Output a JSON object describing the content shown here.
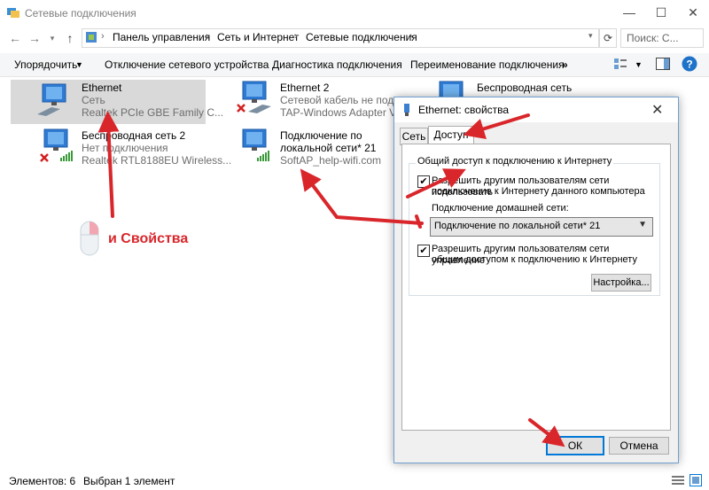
{
  "window": {
    "title": "Сетевые подключения"
  },
  "breadcrumb": [
    "Панель управления",
    "Сеть и Интернет",
    "Сетевые подключения"
  ],
  "search": {
    "placeholder": "Поиск: С..."
  },
  "toolbar": {
    "organize": "Упорядочить",
    "disable": "Отключение сетевого устройства",
    "diagnose": "Диагностика подключения",
    "rename": "Переименование подключения",
    "more": "»"
  },
  "items": [
    {
      "name": "Ethernet",
      "status": "Сеть",
      "adapter": "Realtek PCIe GBE Family C..."
    },
    {
      "name": "Ethernet 2",
      "status": "Сетевой кабель не подкл...",
      "adapter": "TAP-Windows Adapter V9"
    },
    {
      "name": "Беспроводная сеть",
      "status": "",
      "adapter": ""
    },
    {
      "name": "Беспроводная сеть 2",
      "status": "Нет подключения",
      "adapter": "Realtek RTL8188EU Wireless..."
    },
    {
      "name": "Подключение по",
      "status": "локальной сети* 21",
      "adapter": "SoftAP_help-wifi.com"
    }
  ],
  "annotation": {
    "label": "и Свойства"
  },
  "statusbar": {
    "count": "Элементов: 6",
    "selected": "Выбран 1 элемент"
  },
  "dialog": {
    "title": "Ethernet: свойства",
    "tabs": [
      "Сеть",
      "Доступ"
    ],
    "group_label": "Общий доступ к подключению к Интернету",
    "allow_sharing_line1": "Разрешить другим пользователям сети использовать",
    "allow_sharing_line2": "подключение к Интернету данного компьютера",
    "home_network_label": "Подключение домашней сети:",
    "home_network_value": "Подключение по локальной сети* 21",
    "allow_control_line1": "Разрешить другим пользователям сети управление",
    "allow_control_line2": "общим доступом к подключению к Интернету",
    "settings": "Настройка...",
    "ok": "ОК",
    "cancel": "Отмена"
  },
  "colors": {
    "arrow": "#d9262b",
    "accent": "#0078d7"
  }
}
